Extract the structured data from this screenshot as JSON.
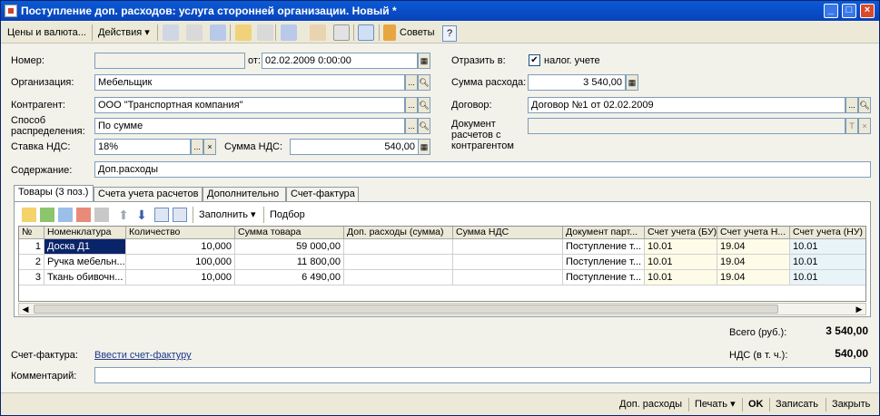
{
  "window": {
    "title": "Поступление доп. расходов: услуга сторонней организации. Новый *",
    "minimize": "_",
    "maximize": "□",
    "close": "×"
  },
  "toolbar": {
    "prices_currency": "Цены и валюта...",
    "actions": "Действия ▾",
    "tips": "Советы",
    "help": "?"
  },
  "form": {
    "number_label": "Номер:",
    "number_value": "",
    "date_label": "от:",
    "date_value": "02.02.2009  0:00:00",
    "organization_label": "Организация:",
    "organization_value": "Мебельщик",
    "counterparty_label": "Контрагент:",
    "counterparty_value": "ООО \"Транспортная компания\"",
    "distribution_label_1": "Способ",
    "distribution_label_2": "распределения:",
    "distribution_value": "По сумме",
    "vat_rate_label": "Ставка НДС:",
    "vat_rate_value": "18%",
    "vat_sum_label": "Сумма НДС:",
    "vat_sum_value": "540,00",
    "reflect_label": "Отразить в:",
    "tax_account_checked": "✔",
    "tax_account_label": "налог. учете",
    "expense_sum_label": "Сумма расхода:",
    "expense_sum_value": "3 540,00",
    "contract_label": "Договор:",
    "contract_value": "Договор №1 от 02.02.2009",
    "settlement_doc_label_1": "Документ",
    "settlement_doc_label_2": "расчетов с",
    "settlement_doc_label_3": "контрагентом",
    "settlement_doc_value": "",
    "content_label": "Содержание:",
    "content_value": "Доп.расходы"
  },
  "tabs": [
    {
      "label": "Товары (3 поз.)"
    },
    {
      "label": "Счета учета расчетов"
    },
    {
      "label": "Дополнительно"
    },
    {
      "label": "Счет-фактура"
    }
  ],
  "grid_toolbar": {
    "fill": "Заполнить ▾",
    "select": "Подбор"
  },
  "grid": {
    "columns": [
      "№",
      "Номенклатура",
      "Количество",
      "Сумма товара",
      "Доп. расходы (сумма)",
      "Сумма НДС",
      "Документ парт...",
      "Счет учета (БУ)",
      "Счет учета Н...",
      "Счет учета (НУ)"
    ],
    "rows": [
      [
        "1",
        "Доска Д1",
        "10,000",
        "59 000,00",
        "",
        "",
        "Поступление т...",
        "10.01",
        "19.04",
        "10.01"
      ],
      [
        "2",
        "Ручка мебельн...",
        "100,000",
        "11 800,00",
        "",
        "",
        "Поступление т...",
        "10.01",
        "19.04",
        "10.01"
      ],
      [
        "3",
        "Ткань обивочн...",
        "10,000",
        "6 490,00",
        "",
        "",
        "Поступление т...",
        "10.01",
        "19.04",
        "10.01"
      ]
    ]
  },
  "totals": {
    "total_label": "Всего (руб.):",
    "total_value": "3 540,00",
    "vat_label": "НДС (в т. ч.):",
    "vat_value": "540,00"
  },
  "invoice": {
    "label": "Счет-фактура:",
    "link": "Ввести счет-фактуру"
  },
  "comment": {
    "label": "Комментарий:",
    "value": ""
  },
  "bottom": {
    "extra_costs": "Доп. расходы",
    "print": "Печать ▾",
    "ok": "OK",
    "save": "Записать",
    "close": "Закрыть"
  }
}
